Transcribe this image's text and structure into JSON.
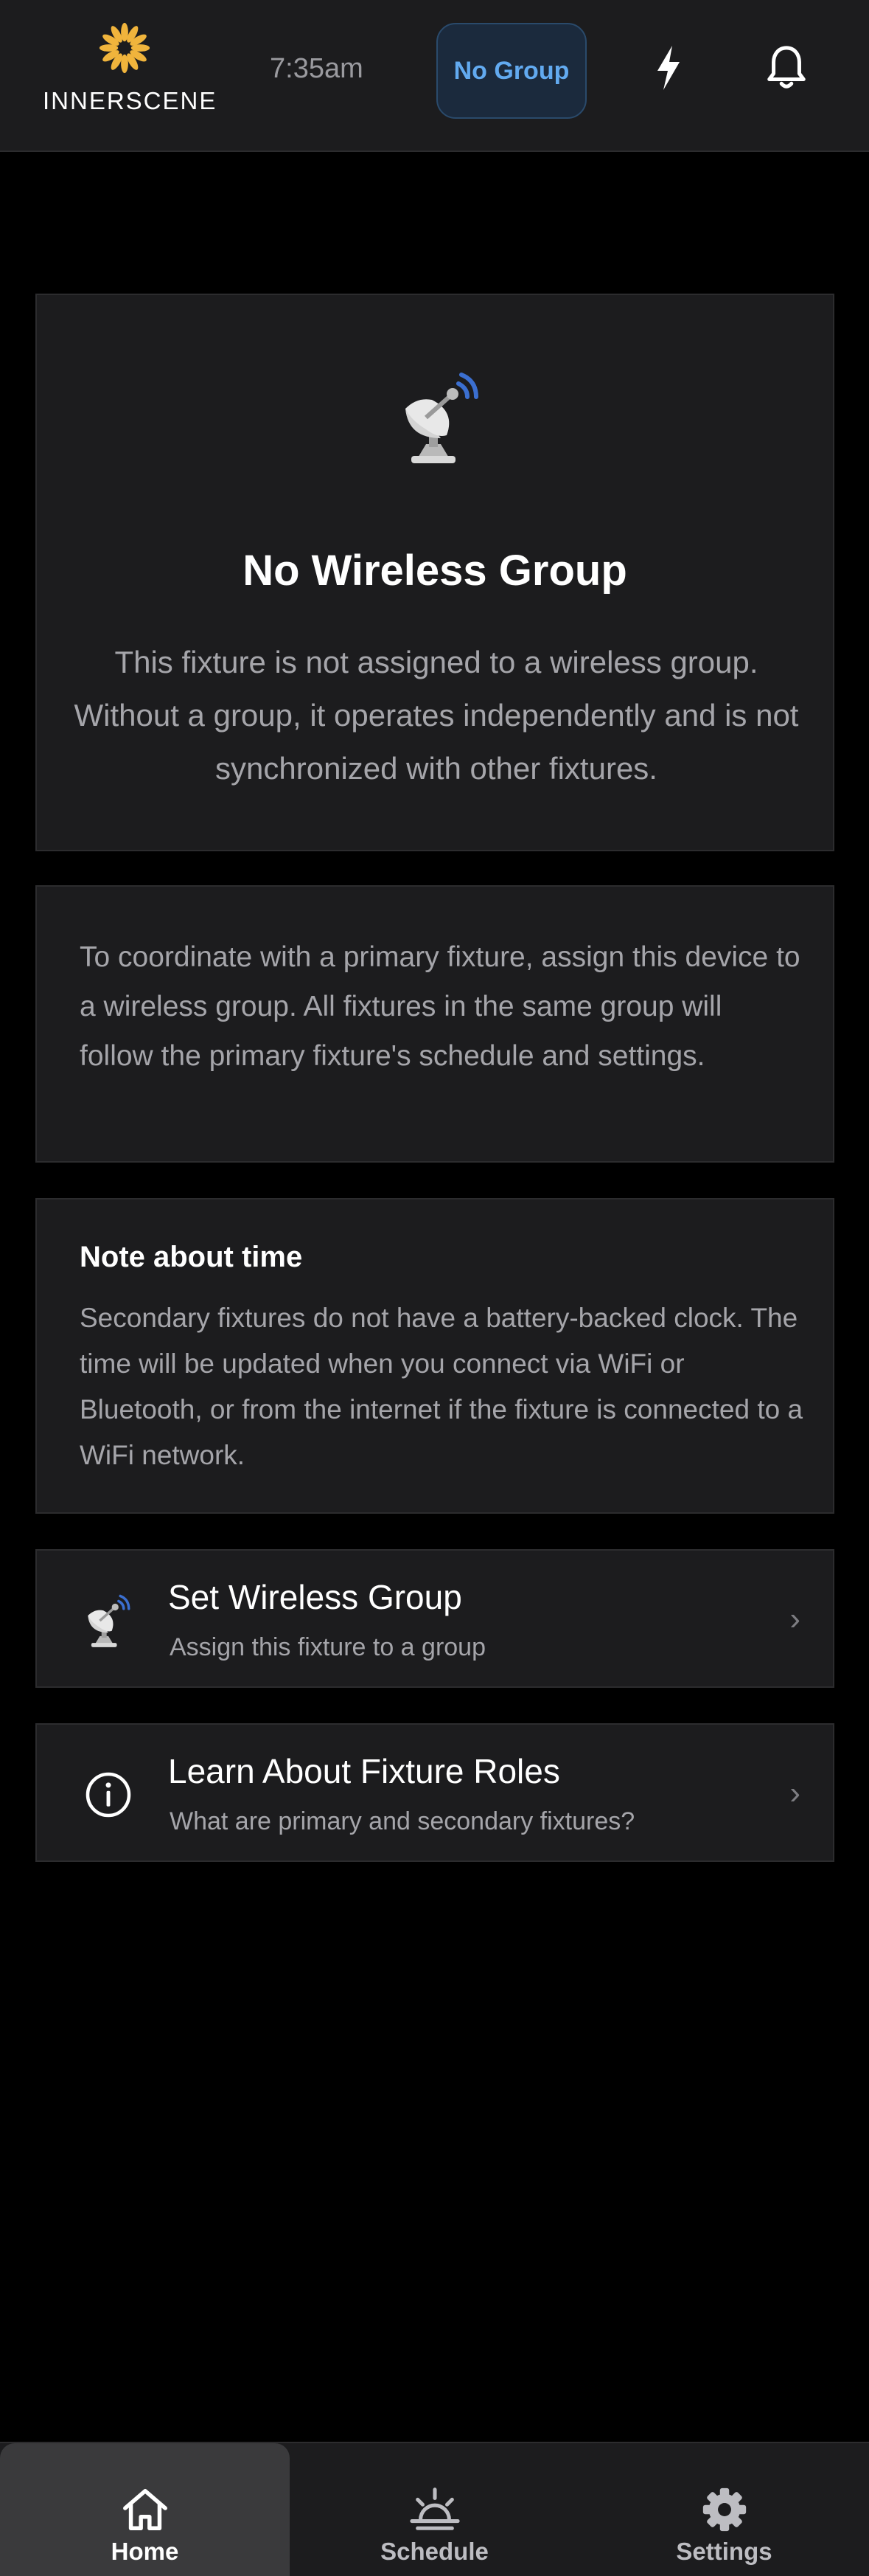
{
  "header": {
    "brand": "INNERSCENE",
    "time": "7:35am",
    "group_button": "No Group",
    "icons": {
      "logo": "sun-logo-icon",
      "power": "lightning-bolt-icon",
      "notifications": "bell-icon"
    }
  },
  "hero": {
    "icon": "satellite-dish-icon",
    "title": "No Wireless Group",
    "description": "This fixture is not assigned to a wireless group. Without a group, it operates independently and is not synchronized with other fixtures."
  },
  "info": {
    "text": "To coordinate with a primary fixture, assign this device to a wireless group. All fixtures in the same group will follow the primary fixture's schedule and settings."
  },
  "note": {
    "title": "Note about time",
    "text": "Secondary fixtures do not have a battery-backed clock. The time will be updated when you connect via WiFi or Bluetooth, or from the internet if the fixture is connected to a WiFi network."
  },
  "actions": [
    {
      "icon": "satellite-dish-icon",
      "title": "Set Wireless Group",
      "subtitle": "Assign this fixture to a group",
      "chevron": "›"
    },
    {
      "icon": "info-circle-icon",
      "title": "Learn About Fixture Roles",
      "subtitle": "What are primary and secondary fixtures?",
      "chevron": "›"
    }
  ],
  "tabs": [
    {
      "label": "Home",
      "icon": "home-icon",
      "active": true
    },
    {
      "label": "Schedule",
      "icon": "sunrise-icon",
      "active": false
    },
    {
      "label": "Settings",
      "icon": "gear-icon",
      "active": false
    }
  ],
  "colors": {
    "background": "#000000",
    "surface": "#1c1c1e",
    "accent_blue": "#62aaf0",
    "logo_gold": "#f0b43c",
    "muted_text": "#a5a5aa"
  }
}
